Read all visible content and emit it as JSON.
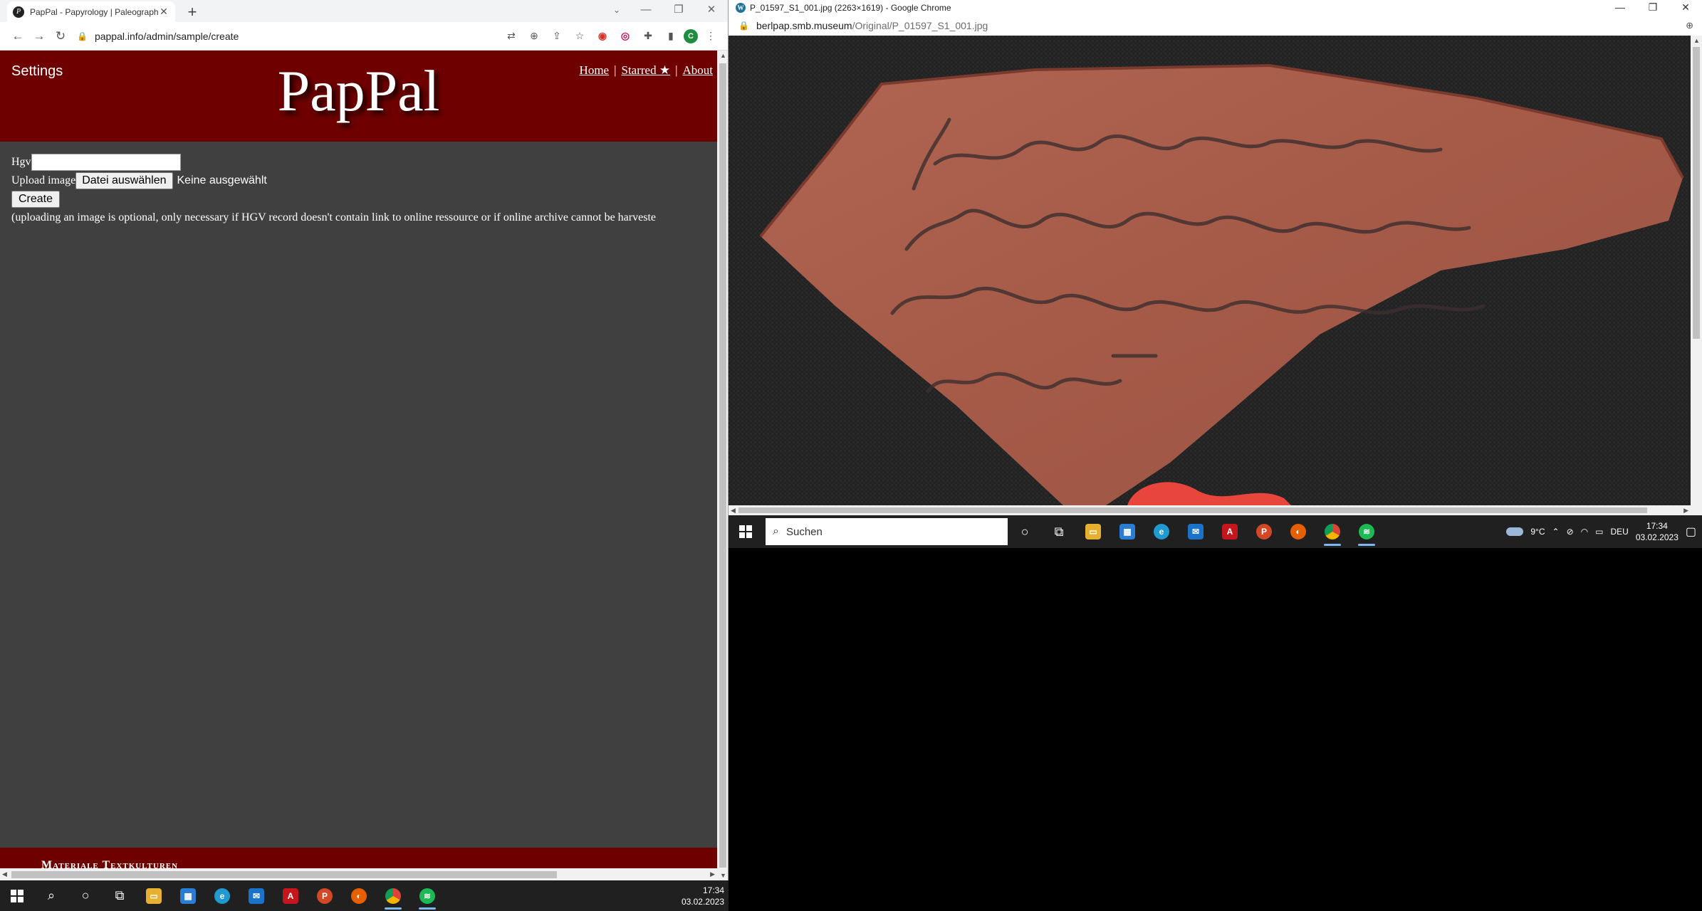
{
  "left_window": {
    "tab_title": "PapPal - Papyrology | Paleograph",
    "tab_favicon": "pappal-favicon",
    "address": "pappal.info/admin/sample/create"
  },
  "site": {
    "settings_label": "Settings",
    "logo_text": "PapPal",
    "nav": {
      "home": "Home",
      "starred": "Starred ★",
      "about": "About",
      "separator": "|"
    },
    "form": {
      "hgv_label": "Hgv",
      "hgv_value": "",
      "upload_label": "Upload image",
      "file_button": "Datei auswählen",
      "file_status": "Keine ausgewählt",
      "create_button": "Create",
      "note": "(uploading an image is optional, only necessary if HGV record doesn't contain link to online ressource or if online archive cannot be harveste"
    },
    "footer_text": "Materiale Textkulturen",
    "brand_color": "#6e0000",
    "background_color": "#404040"
  },
  "taskbar_left": {
    "time": "17:34",
    "date": "03.02.2023"
  },
  "right_window": {
    "title": "P_01597_S1_001.jpg (2263×1619) - Google Chrome",
    "address_host": "berlpap.smb.museum",
    "address_path": "/Original/P_01597_S1_001.jpg"
  },
  "taskbar_right": {
    "search_placeholder": "Suchen",
    "temperature": "9°C",
    "language": "DEU",
    "time": "17:34",
    "date": "03.02.2023"
  }
}
